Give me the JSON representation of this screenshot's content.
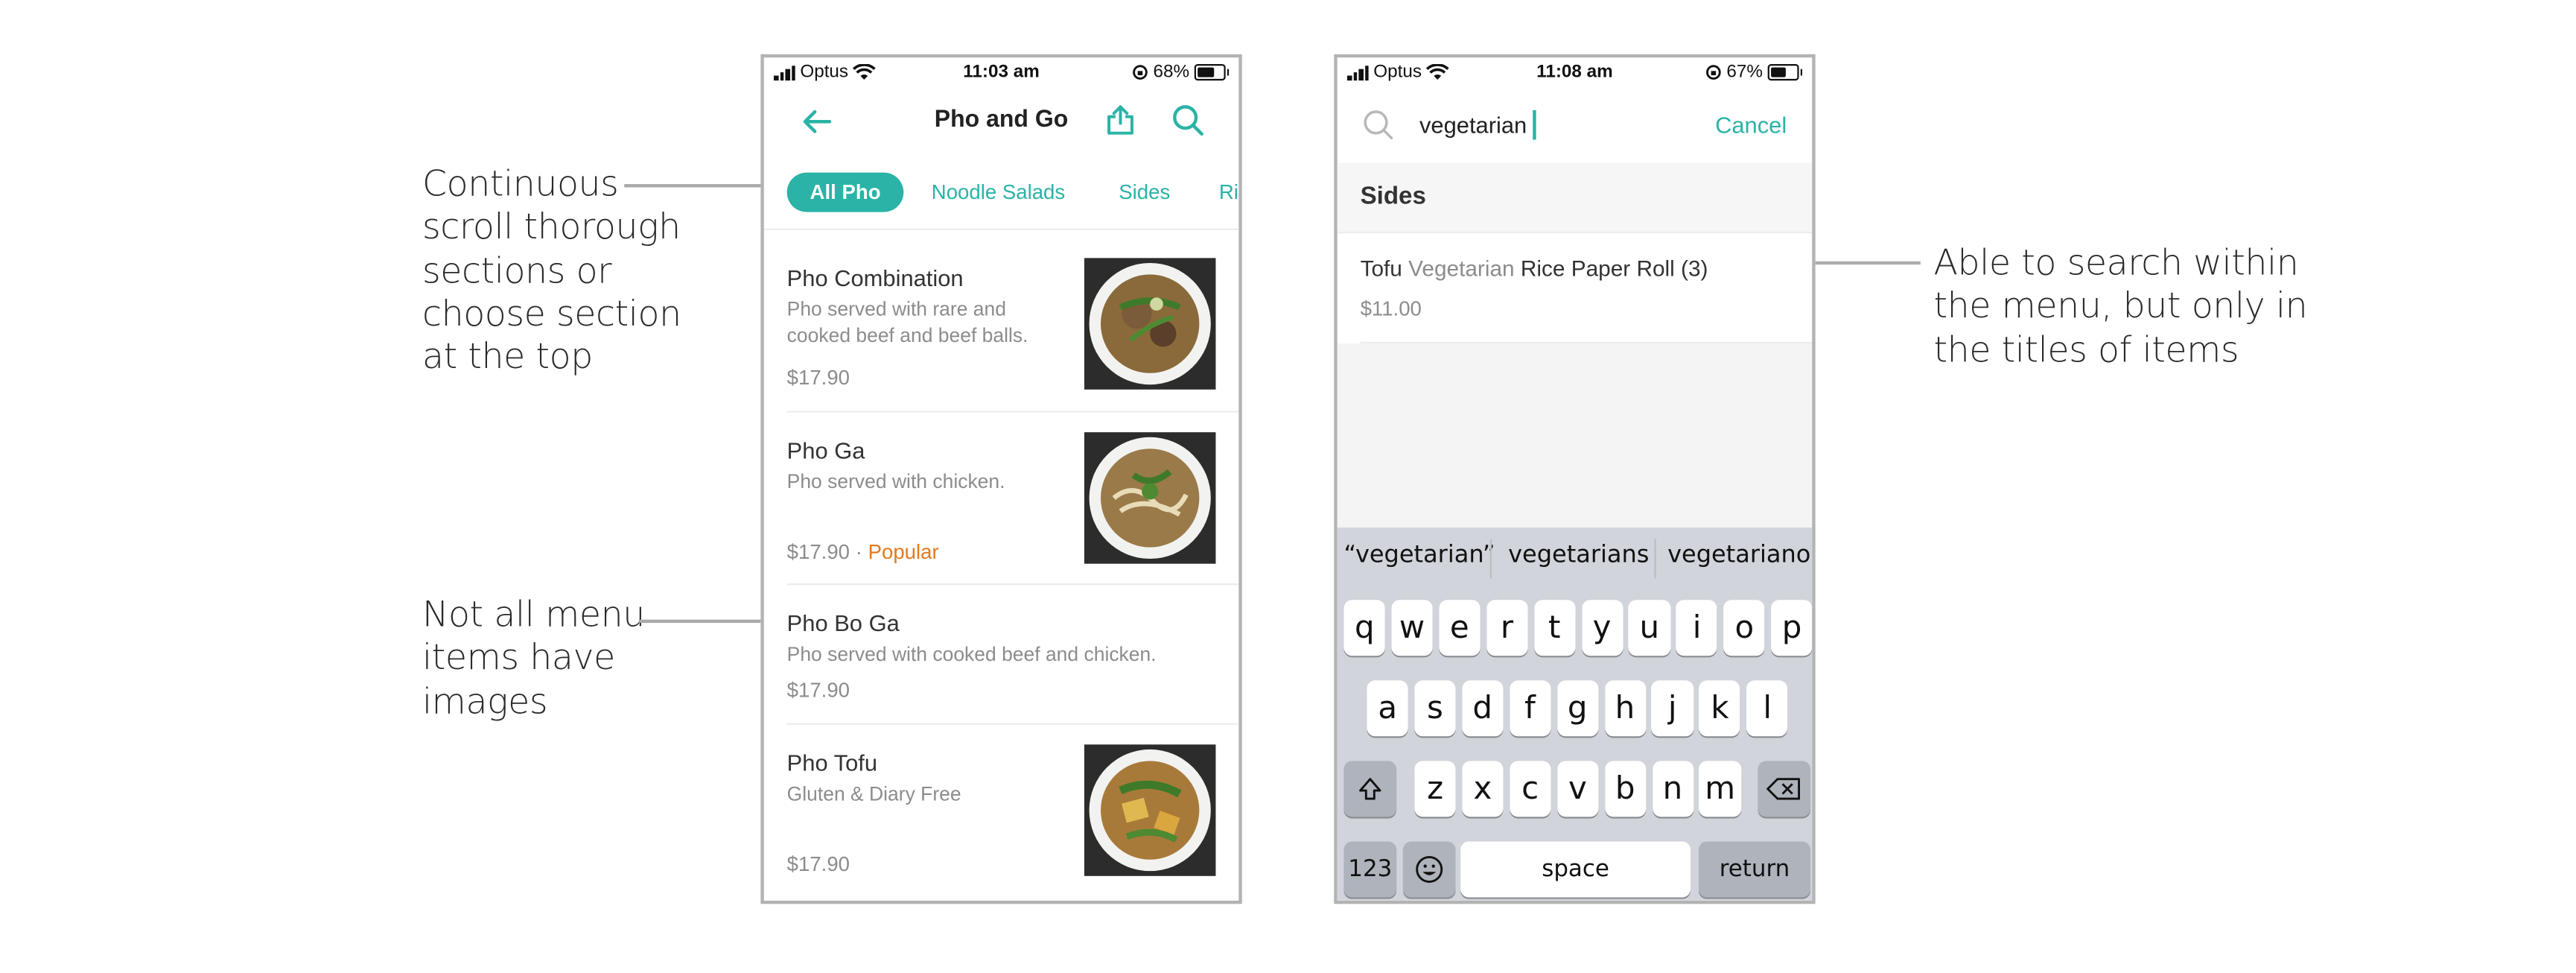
{
  "annotations": {
    "left_top": [
      "Continuous",
      "scroll thorough",
      "sections or",
      "choose section",
      "at the top"
    ],
    "left_bottom": [
      "Not all menu",
      "items have",
      "images"
    ],
    "right": [
      "Able to search within",
      "the menu, but only in",
      "the titles of items"
    ]
  },
  "status_left": {
    "carrier": "Optus",
    "time": "11:03 am",
    "battery": "68%",
    "battery_level": 0.68
  },
  "status_right": {
    "carrier": "Optus",
    "time": "11:08 am",
    "battery": "67%",
    "battery_level": 0.67
  },
  "menu_screen": {
    "title": "Pho and Go",
    "icons": {
      "back": "back-arrow-icon",
      "share": "share-icon",
      "search": "search-icon"
    },
    "tabs": [
      "All Pho",
      "Noodle Salads",
      "Sides",
      "Ri"
    ],
    "items": [
      {
        "name": "Pho Combination",
        "desc_lines": [
          "Pho served with rare and",
          "cooked beef and beef balls."
        ],
        "price": "$17.90",
        "has_image": true
      },
      {
        "name": "Pho Ga",
        "desc_lines": [
          "Pho served with chicken."
        ],
        "price": "$17.90",
        "tag": "Popular",
        "has_image": true
      },
      {
        "name": "Pho Bo Ga",
        "desc_lines": [
          "Pho served with cooked beef and chicken."
        ],
        "price": "$17.90",
        "has_image": false
      },
      {
        "name": "Pho Tofu",
        "desc_lines": [
          "Gluten & Diary Free"
        ],
        "price": "$17.90",
        "has_image": true
      }
    ],
    "separator": "·"
  },
  "search_screen": {
    "query": "vegetarian",
    "cancel": "Cancel",
    "section": "Sides",
    "result": {
      "before": "Tofu ",
      "match": "Vegetarian",
      "after": " Rice Paper Roll (3)",
      "price": "$11.00"
    },
    "suggestions": [
      "“vegetarian”",
      "vegetarians",
      "vegetariano"
    ],
    "keyboard": {
      "row1": [
        "q",
        "w",
        "e",
        "r",
        "t",
        "y",
        "u",
        "i",
        "o",
        "p"
      ],
      "row2": [
        "a",
        "s",
        "d",
        "f",
        "g",
        "h",
        "j",
        "k",
        "l"
      ],
      "row3": [
        "z",
        "x",
        "c",
        "v",
        "b",
        "n",
        "m"
      ],
      "numbers": "123",
      "space": "space",
      "return": "return"
    }
  },
  "colors": {
    "accent": "#2ab3a6",
    "popular": "#e27a1e",
    "keyboard_bg": "#d1d4da"
  }
}
